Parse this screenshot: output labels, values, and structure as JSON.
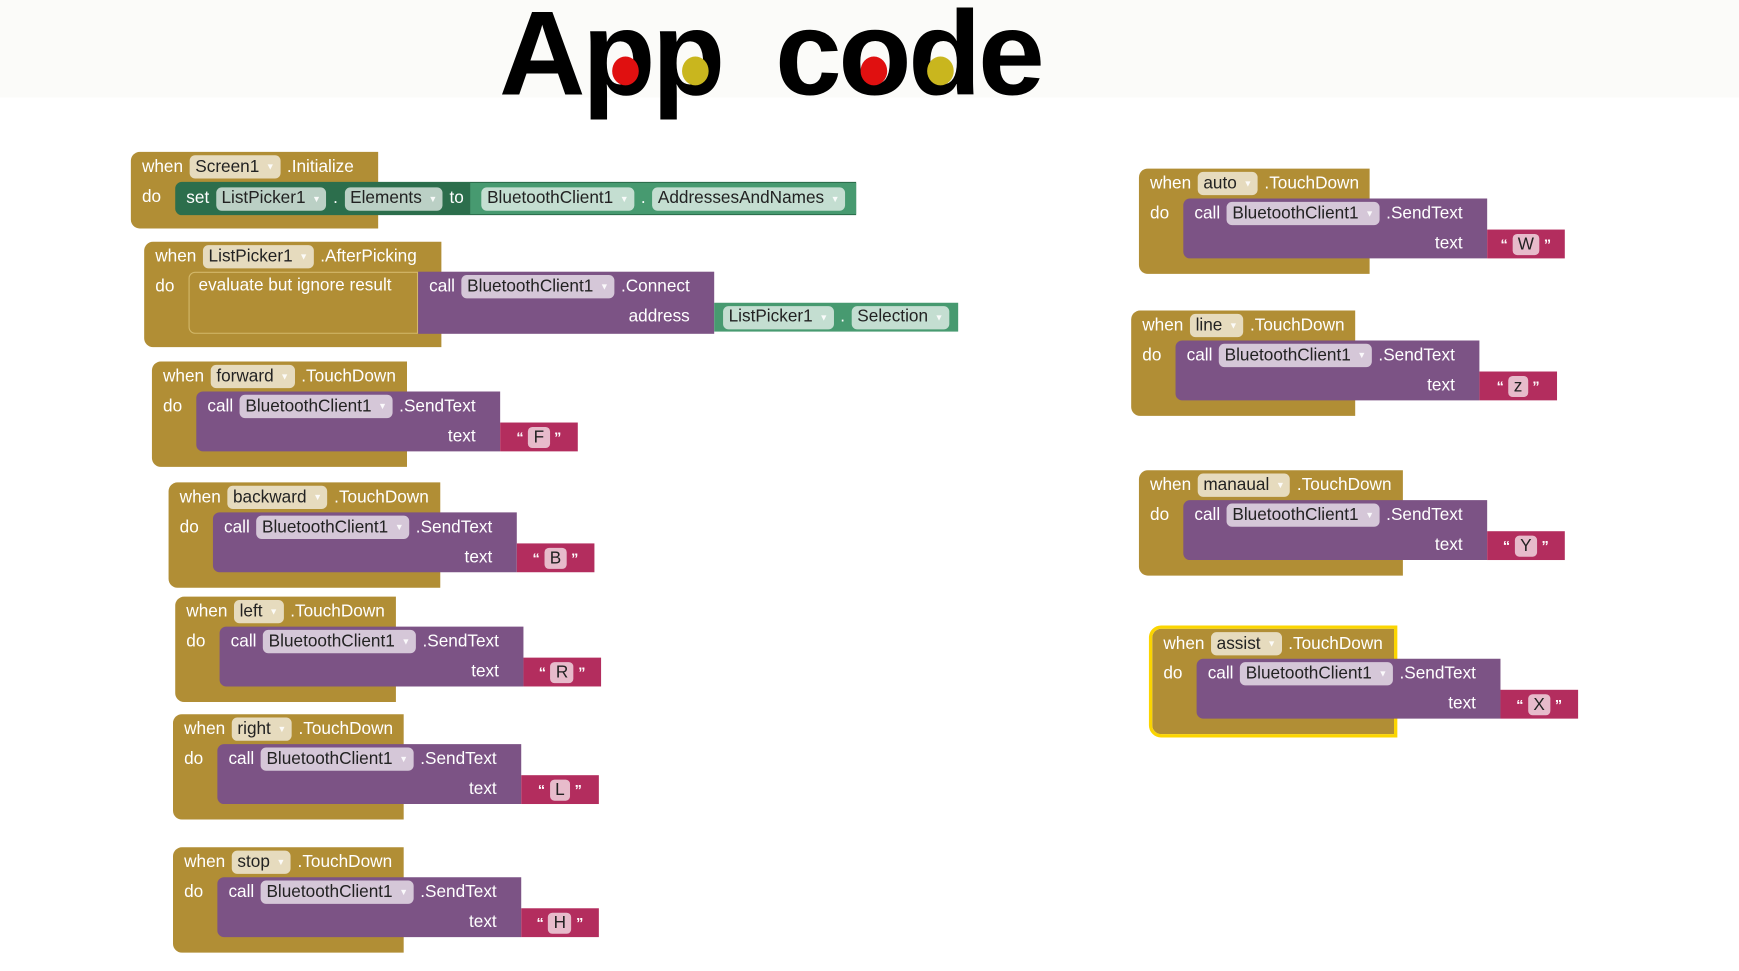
{
  "title": {
    "word1": "App",
    "word2": "code",
    "dot_colors": [
      "#e01010",
      "#c9b61e"
    ]
  },
  "colors": {
    "event": "#b18e35",
    "procedure": "#7c5385",
    "text": "#b32d5e",
    "setter": "#2c6e4c",
    "getter": "#479a70",
    "selected_outline": "#fbd500"
  },
  "keywords": {
    "when": "when",
    "do": "do",
    "call": "call",
    "set": "set",
    "to": "to",
    "text": "text",
    "address": "address",
    "evaluate": "evaluate but ignore result",
    "dot": ".",
    "open_quote": "“",
    "close_quote": "”",
    "dropdown_icon": "triangle-down"
  },
  "init_block": {
    "component": "Screen1",
    "event": ".Initialize",
    "set_component": "ListPicker1",
    "property": "Elements",
    "value_component": "BluetoothClient1",
    "value_property": "AddressesAndNames"
  },
  "picking_block": {
    "component": "ListPicker1",
    "event": ".AfterPicking",
    "call_component": "BluetoothClient1",
    "method": ".Connect",
    "arg_component": "ListPicker1",
    "arg_property": "Selection"
  },
  "touch_blocks": [
    {
      "button": "forward",
      "event": ".TouchDown",
      "component": "BluetoothClient1",
      "method": ".SendText",
      "value": "F",
      "selected": false
    },
    {
      "button": "backward",
      "event": ".TouchDown",
      "component": "BluetoothClient1",
      "method": ".SendText",
      "value": "B",
      "selected": false
    },
    {
      "button": "left",
      "event": ".TouchDown",
      "component": "BluetoothClient1",
      "method": ".SendText",
      "value": "R",
      "selected": false
    },
    {
      "button": "right",
      "event": ".TouchDown",
      "component": "BluetoothClient1",
      "method": ".SendText",
      "value": "L",
      "selected": false
    },
    {
      "button": "stop",
      "event": ".TouchDown",
      "component": "BluetoothClient1",
      "method": ".SendText",
      "value": "H",
      "selected": false
    },
    {
      "button": "auto",
      "event": ".TouchDown",
      "component": "BluetoothClient1",
      "method": ".SendText",
      "value": "W",
      "selected": false
    },
    {
      "button": "line",
      "event": ".TouchDown",
      "component": "BluetoothClient1",
      "method": ".SendText",
      "value": "z",
      "selected": false
    },
    {
      "button": "manaual",
      "event": ".TouchDown",
      "component": "BluetoothClient1",
      "method": ".SendText",
      "value": "Y",
      "selected": false
    },
    {
      "button": "assist",
      "event": ".TouchDown",
      "component": "BluetoothClient1",
      "method": ".SendText",
      "value": "X",
      "selected": true
    }
  ]
}
